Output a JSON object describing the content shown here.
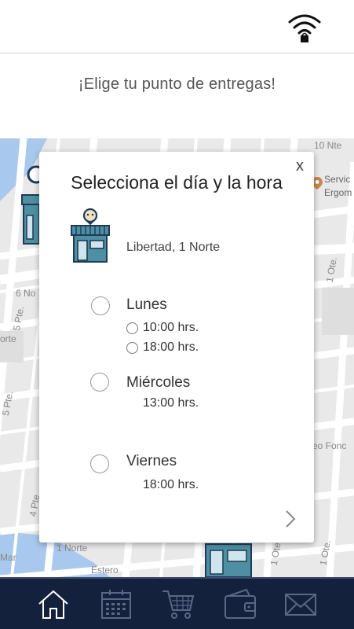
{
  "header": {
    "title": "¡Elige tu punto de entregas!"
  },
  "map": {
    "labels": [
      "10 Nte",
      "Servic",
      "Ergom",
      "1 Ote.",
      "6 No",
      "5 Pte.",
      "orte",
      "5 Pte.",
      "4 Pte",
      "1 Norte",
      "Estero",
      "Mar",
      "eo Fonc",
      "1 Ote.",
      "1 Ote."
    ]
  },
  "modal": {
    "close_label": "x",
    "title": "Selecciona el día y la hora",
    "store_name": "Libertad, 1 Norte",
    "days": [
      {
        "label": "Lunes",
        "hours": [
          "10:00 hrs.",
          "18:00 hrs."
        ]
      },
      {
        "label": "Miércoles",
        "hours": [
          "13:00 hrs."
        ]
      },
      {
        "label": "Viernes",
        "hours": [
          "18:00 hrs."
        ]
      }
    ]
  },
  "nav": {
    "items": [
      "home-icon",
      "calendar-icon",
      "cart-icon",
      "wallet-icon",
      "mail-icon"
    ],
    "active": "home-icon"
  },
  "colors": {
    "nav_bg": "#14213d",
    "store_teal": "#4f8fa3",
    "store_dark": "#1d3b55"
  }
}
